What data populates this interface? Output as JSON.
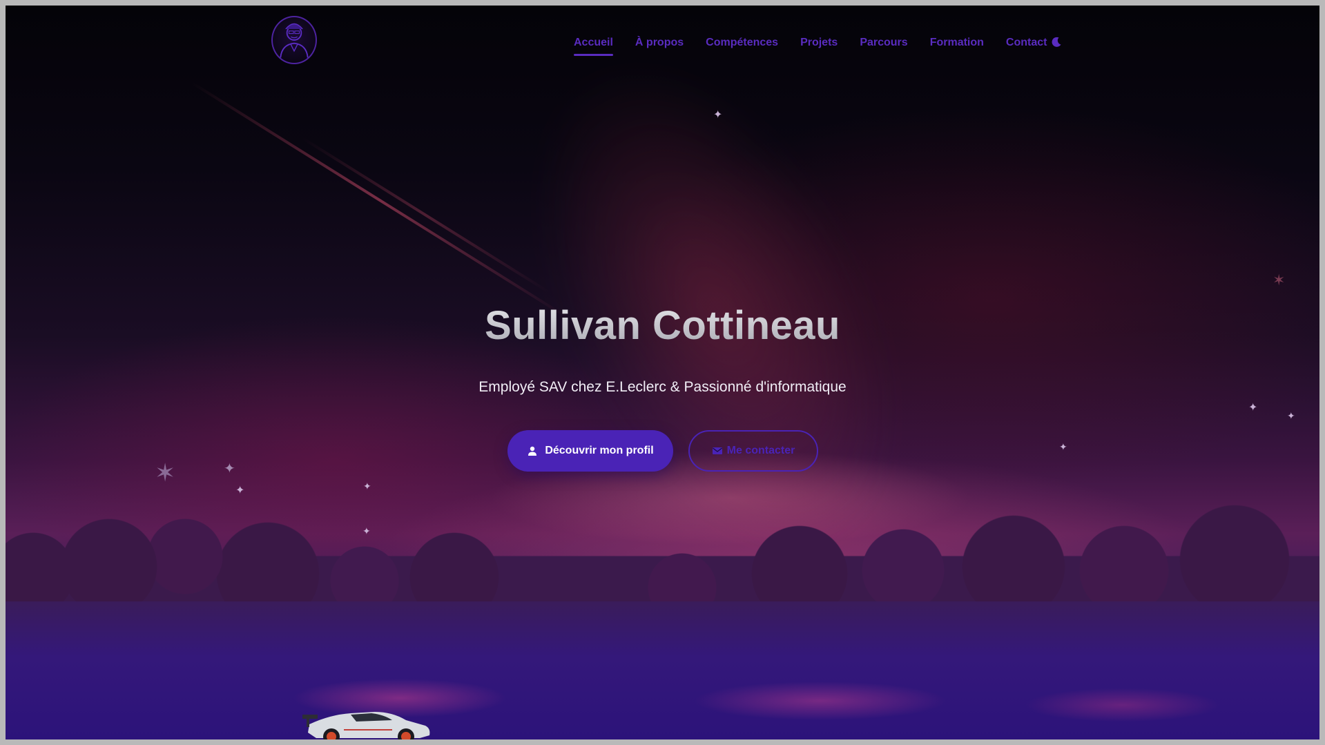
{
  "nav": {
    "items": [
      {
        "label": "Accueil",
        "active": true
      },
      {
        "label": "À propos",
        "active": false
      },
      {
        "label": "Compétences",
        "active": false
      },
      {
        "label": "Projets",
        "active": false
      },
      {
        "label": "Parcours",
        "active": false
      },
      {
        "label": "Formation",
        "active": false
      },
      {
        "label": "Contact",
        "active": false
      }
    ],
    "theme_toggle_icon": "moon-icon",
    "logo_icon": "avatar-logo-icon"
  },
  "hero": {
    "title": "Sullivan Cottineau",
    "subtitle": "Employé SAV chez E.Leclerc & Passionné d'informatique",
    "primary_button": {
      "label": "Découvrir mon profil",
      "icon": "user-icon"
    },
    "secondary_button": {
      "label": "Me contacter",
      "icon": "envelope-icon"
    }
  },
  "colors": {
    "accent": "#4a23b6",
    "nav_text": "#5a2cc0",
    "title": "#d0d0d6",
    "subtitle": "#f1eef6"
  }
}
